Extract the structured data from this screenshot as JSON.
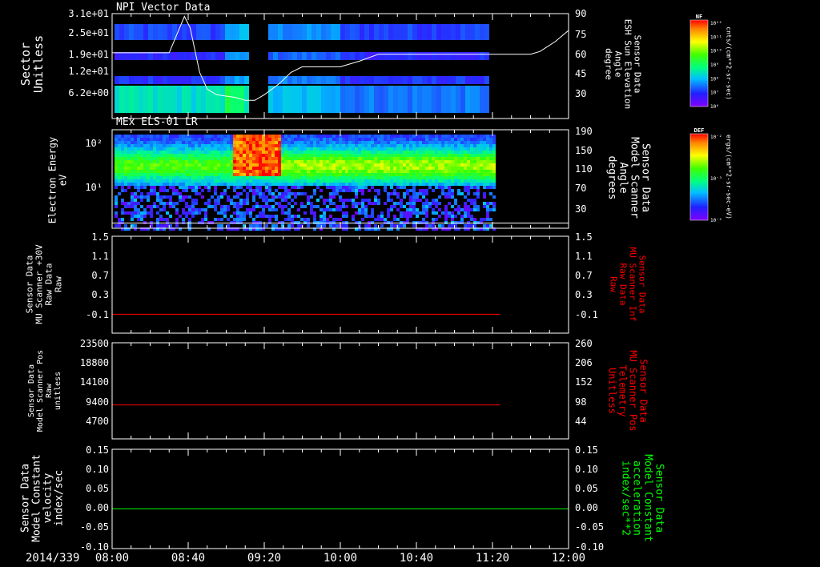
{
  "time_axis": {
    "ticks": [
      "08:00",
      "08:40",
      "09:20",
      "10:00",
      "10:40",
      "11:20",
      "12:00"
    ],
    "day_label": "2014/339",
    "range": [
      "08:00",
      "12:00"
    ]
  },
  "colors": {
    "background": "#000000",
    "foreground": "#ffffff",
    "red_trace": "#ff0000",
    "green_trace": "#00ff00"
  },
  "chart_data": [
    {
      "type": "heatmap",
      "title": "NPI Vector Data",
      "ylabel": "Sector Unitless",
      "yticks": [
        "3.1e+01",
        "2.5e+01",
        "1.9e+01",
        "1.2e+01",
        "6.2e+00"
      ],
      "ylim": [
        0,
        31
      ],
      "y2label": [
        "Sensor Data",
        "ESH Sun Elevation",
        "Angle",
        "degree"
      ],
      "y2ticks": [
        "90",
        "75",
        "60",
        "45",
        "30"
      ],
      "y2lim": [
        15,
        90
      ],
      "colorbar": {
        "label": "NF",
        "units": "cnts/(cm**2-sr-sec)",
        "ticks": [
          "10¹²",
          "10¹¹",
          "10¹⁰",
          "10⁹",
          "10⁸",
          "10⁷",
          "10⁶"
        ]
      },
      "overlay_line": {
        "name": "ESH Sun Elevation Angle",
        "units": "degree",
        "points": [
          [
            "08:00",
            62
          ],
          [
            "08:30",
            62
          ],
          [
            "08:34",
            75
          ],
          [
            "08:38",
            88
          ],
          [
            "08:41",
            80
          ],
          [
            "08:46",
            48
          ],
          [
            "08:50",
            36
          ],
          [
            "08:55",
            32
          ],
          [
            "09:05",
            30
          ],
          [
            "09:10",
            28
          ],
          [
            "09:15",
            28
          ],
          [
            "09:20",
            32
          ],
          [
            "09:28",
            40
          ],
          [
            "09:34",
            48
          ],
          [
            "09:40",
            52
          ],
          [
            "10:00",
            52
          ],
          [
            "10:10",
            56
          ],
          [
            "10:20",
            61
          ],
          [
            "11:40",
            61
          ],
          [
            "11:45",
            63
          ],
          [
            "11:53",
            70
          ],
          [
            "12:00",
            78
          ]
        ]
      }
    },
    {
      "type": "heatmap",
      "title": "MEx ELS-01 LR",
      "ylabel": "Electron Energy eV",
      "yticks": [
        "10²",
        "10¹"
      ],
      "ylog": true,
      "y2label": [
        "Sensor Data",
        "Model Scanner",
        "Angle",
        "degrees"
      ],
      "y2ticks": [
        "190",
        "150",
        "110",
        "70",
        "30"
      ],
      "y2lim": [
        0,
        190
      ],
      "colorbar": {
        "label": "DEF",
        "units": "ergs/(cm**2-sr-sec-eV)",
        "ticks": [
          "10⁻²",
          "10⁻³",
          "10⁻⁴"
        ]
      },
      "overlay_line": {
        "name": "Model Scanner Angle",
        "points": [
          [
            "08:00",
            10
          ],
          [
            "12:00",
            10
          ]
        ]
      }
    },
    {
      "type": "line",
      "ylabel": [
        "Sensor Data",
        "MU Scanner +30V",
        "Raw Data",
        "Raw"
      ],
      "yticks": [
        "1.5",
        "1.1",
        "0.7",
        "0.3",
        "-0.1"
      ],
      "ylim": [
        -0.4,
        1.5
      ],
      "y2label": [
        "Sensor Data",
        "MU Scanner Inf",
        "Raw Data",
        "Raw"
      ],
      "y2ticks": [
        "1.5",
        "1.1",
        "0.7",
        "0.3",
        "-0.1"
      ],
      "series": [
        {
          "color": "#ff0000",
          "x": [
            "08:00",
            "11:24"
          ],
          "y": [
            -0.03,
            -0.03
          ]
        }
      ]
    },
    {
      "type": "line",
      "ylabel": [
        "Sensor Data",
        "Model Scanner Pos",
        "Raw",
        "unitless"
      ],
      "yticks": [
        "23500",
        "18800",
        "14100",
        "9400",
        "4700"
      ],
      "ylim": [
        0,
        23500
      ],
      "y2label": [
        "Sensor Data",
        "MU Scanner Pos",
        "Telemetry",
        "Unitless"
      ],
      "y2ticks": [
        "260",
        "206",
        "152",
        "98",
        "44"
      ],
      "series": [
        {
          "color": "#ff0000",
          "x": [
            "08:00",
            "11:24"
          ],
          "y": [
            8300,
            8300
          ]
        }
      ]
    },
    {
      "type": "line",
      "ylabel": [
        "Sensor Data",
        "Model Constant",
        "velocity",
        "index/sec"
      ],
      "yticks": [
        "0.15",
        "0.10",
        "0.05",
        "0.00",
        "-0.05",
        "-0.10"
      ],
      "ylim": [
        -0.1,
        0.15
      ],
      "y2label": [
        "Sensor Data",
        "Model Constant",
        "acceleration",
        "index/sec**2"
      ],
      "y2ticks": [
        "0.15",
        "0.10",
        "0.05",
        "0.00",
        "-0.05",
        "-0.10"
      ],
      "series": [
        {
          "color": "#00ff00",
          "x": [
            "08:00",
            "12:00"
          ],
          "y": [
            0.0,
            0.0
          ]
        }
      ]
    }
  ]
}
